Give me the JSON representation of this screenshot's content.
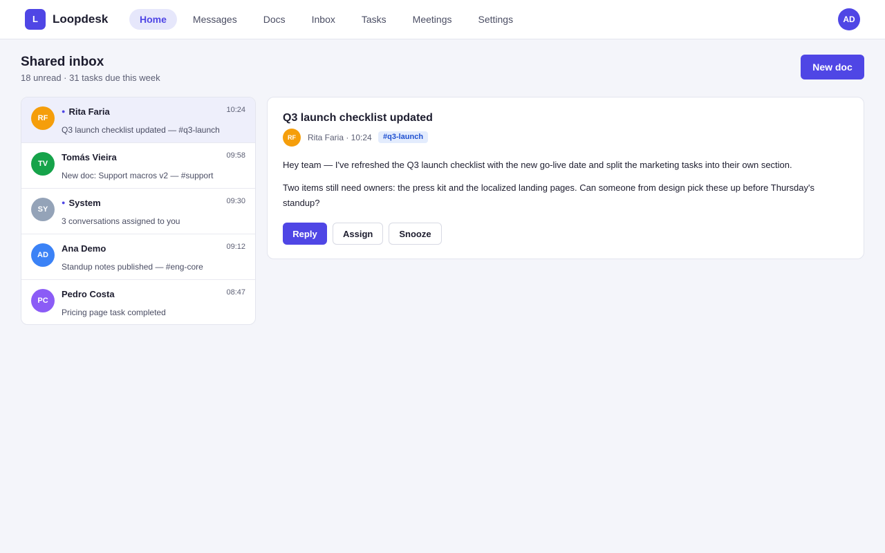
{
  "app": {
    "logo_letter": "L",
    "name": "Loopdesk",
    "user_initials": "AD"
  },
  "nav": {
    "items": [
      {
        "label": "Home",
        "active": true
      },
      {
        "label": "Messages"
      },
      {
        "label": "Docs"
      },
      {
        "label": "Inbox"
      },
      {
        "label": "Tasks"
      },
      {
        "label": "Meetings"
      },
      {
        "label": "Settings"
      }
    ]
  },
  "header": {
    "title": "Shared inbox",
    "subtitle": "18 unread · 31 tasks due this week",
    "new_doc_label": "New doc"
  },
  "conversations": [
    {
      "initials": "RF",
      "name": "Rita Faria",
      "unread": true,
      "time": "10:24",
      "preview": "Q3 launch checklist updated — #q3-launch",
      "avatar_color": "#f59e0b",
      "selected": true
    },
    {
      "initials": "TV",
      "name": "Tomás Vieira",
      "unread": false,
      "time": "09:58",
      "preview": "New doc: Support macros v2 — #support",
      "avatar_color": "#16a34a"
    },
    {
      "initials": "SY",
      "name": "System",
      "unread": true,
      "time": "09:30",
      "preview": "3 conversations assigned to you",
      "avatar_color": "#94a3b8"
    },
    {
      "initials": "AD",
      "name": "Ana Demo",
      "unread": false,
      "time": "09:12",
      "preview": "Standup notes published — #eng-core",
      "avatar_color": "#3b82f6"
    },
    {
      "initials": "PC",
      "name": "Pedro Costa",
      "unread": false,
      "time": "08:47",
      "preview": "Pricing page task completed",
      "avatar_color": "#8b5cf6"
    }
  ],
  "detail": {
    "title": "Q3 launch checklist updated",
    "avatar_initials": "RF",
    "meta": "Rita Faria · 10:24",
    "tag": "#q3-launch",
    "paragraphs": [
      "Hey team — I've refreshed the Q3 launch checklist with the new go-live date and split the marketing tasks into their own section.",
      "Two items still need owners: the press kit and the localized landing pages. Can someone from design pick these up before Thursday's standup?"
    ],
    "actions": {
      "reply": "Reply",
      "assign": "Assign",
      "snooze": "Snooze"
    }
  },
  "colors": {
    "accent": "#4f46e5",
    "background": "#f4f5fa",
    "tag_text": "#1e4fd0",
    "tag_bg": "#e3ecfd"
  },
  "unread_marker": "●"
}
